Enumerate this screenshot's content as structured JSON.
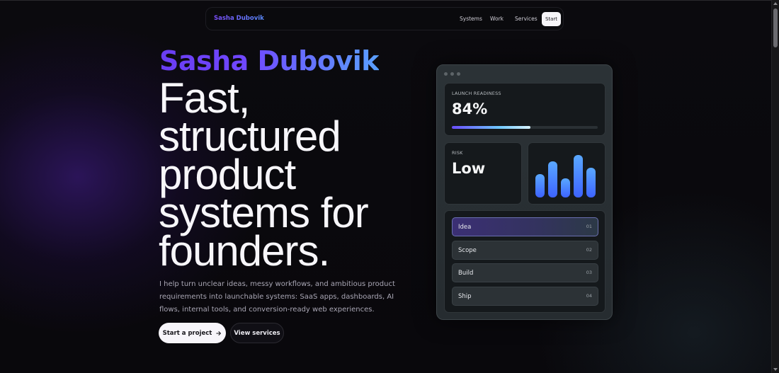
{
  "nav": {
    "brand": "Sasha Dubovik",
    "links": [
      "Systems",
      "Work",
      "Services"
    ],
    "cta": "Start"
  },
  "hero": {
    "name": "Sasha Dubovik",
    "headline_lines": [
      "Fast,",
      "structured",
      "product",
      "systems for",
      "founders."
    ],
    "description": "I help turn unclear ideas, messy workflows, and ambitious product requirements into launchable systems: SaaS apps, dashboards, AI flows, internal tools, and conversion-ready web experiences.",
    "primary_button": "Start a project",
    "secondary_button": "View services"
  },
  "dashboard": {
    "launch": {
      "label": "LAUNCH READINESS",
      "value": "84%",
      "progress": 0.54
    },
    "risk": {
      "label": "RISK",
      "value": "Low"
    },
    "bars": [
      0.55,
      0.85,
      0.45,
      1.0,
      0.7
    ],
    "steps": [
      {
        "name": "Idea",
        "num": "01",
        "active": true
      },
      {
        "name": "Scope",
        "num": "02",
        "active": false
      },
      {
        "name": "Build",
        "num": "03",
        "active": false
      },
      {
        "name": "Ship",
        "num": "04",
        "active": false
      }
    ],
    "colors": {
      "bar_top": "#5aa8ff",
      "bar_bottom": "#3d63ff"
    }
  }
}
